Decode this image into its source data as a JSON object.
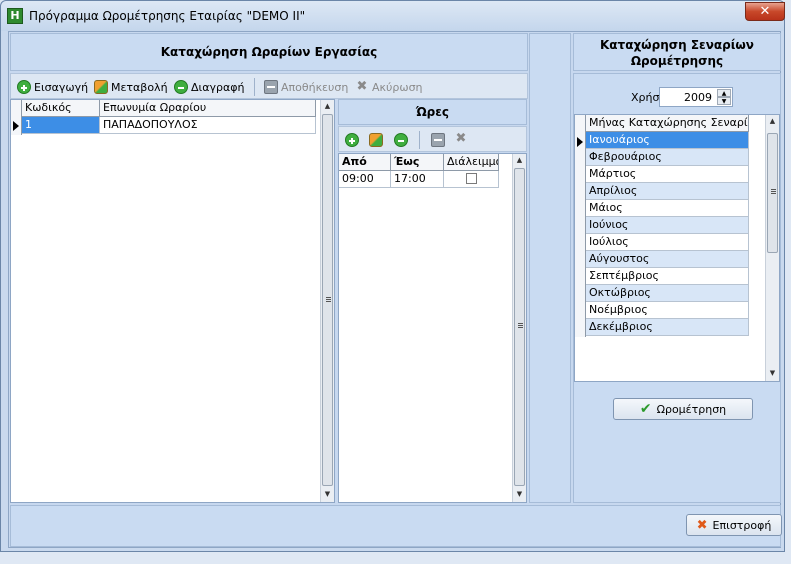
{
  "window": {
    "title": "Πρόγραμμα Ωρομέτρησης Εταιρίας \"DEMO II\"",
    "close_label": "✕"
  },
  "schedules": {
    "title": "Καταχώρηση Ωραρίων Εργασίας",
    "toolbar": {
      "add": "Εισαγωγή",
      "edit": "Μεταβολή",
      "delete": "Διαγραφή",
      "save": "Αποθήκευση",
      "cancel": "Ακύρωση"
    },
    "columns": [
      "Κωδικός",
      "Επωνυμία Ωραρίου"
    ],
    "rows": [
      {
        "code": "1",
        "name": "ΠΑΠΑΔΟΠΟΥΛΟΣ"
      }
    ]
  },
  "hours": {
    "title": "Ώρες",
    "columns": [
      "Από",
      "Έως",
      "Διάλειμμα"
    ],
    "rows": [
      {
        "from": "09:00",
        "to": "17:00",
        "break": false
      }
    ]
  },
  "scenarios": {
    "title": "Καταχώρηση Σεναρίων Ωρομέτρησης",
    "year_label": "Χρήση",
    "year_value": "2009",
    "column": "Μήνας Καταχώρησης Σεναρίου",
    "months": [
      "Ιανουάριος",
      "Φεβρουάριος",
      "Μάρτιος",
      "Απρίλιος",
      "Μάιος",
      "Ιούνιος",
      "Ιούλιος",
      "Αύγουστος",
      "Σεπτέμβριος",
      "Οκτώβριος",
      "Νοέμβριος",
      "Δεκέμβριος"
    ],
    "selected_index": 0,
    "run_button": "Ωρομέτρηση"
  },
  "footer": {
    "back_button": "Επιστροφή"
  },
  "colors": {
    "selected_row": "#3d8ee6",
    "alt_row": "#d8e6f7"
  }
}
